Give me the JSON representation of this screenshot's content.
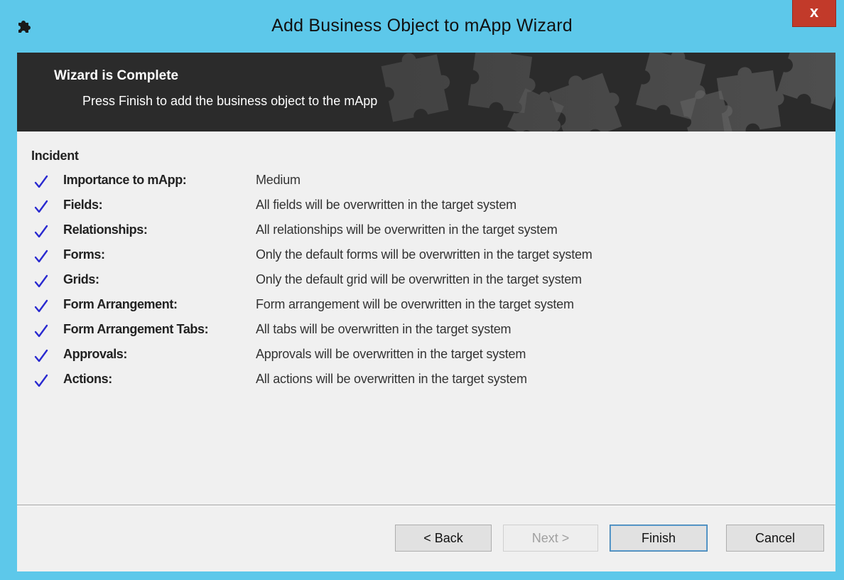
{
  "window": {
    "title": "Add Business Object to mApp Wizard",
    "close_label": "x",
    "icon": "puzzle-icon",
    "colors": {
      "titlebar": "#5dc8ea",
      "close": "#c23a2a",
      "banner": "#2b2b2b",
      "client": "#f0f0f0",
      "check": "#2a2ad0"
    }
  },
  "banner": {
    "title": "Wizard is Complete",
    "subtitle": "Press Finish to add the business object to the mApp"
  },
  "summary": {
    "object_name": "Incident",
    "items": [
      {
        "label": "Importance to mApp:",
        "value": "Medium",
        "icon": "checkmark-icon"
      },
      {
        "label": "Fields:",
        "value": "All fields will be overwritten in the target system",
        "icon": "checkmark-icon"
      },
      {
        "label": "Relationships:",
        "value": "All relationships will be overwritten in the target system",
        "icon": "checkmark-icon"
      },
      {
        "label": "Forms:",
        "value": "Only the default forms will be overwritten in the target system",
        "icon": "checkmark-icon"
      },
      {
        "label": "Grids:",
        "value": "Only the default grid will be overwritten in the target system",
        "icon": "checkmark-icon"
      },
      {
        "label": "Form Arrangement:",
        "value": "Form arrangement will be overwritten in the target system",
        "icon": "checkmark-icon"
      },
      {
        "label": "Form Arrangement Tabs:",
        "value": "All tabs will be overwritten in the target system",
        "icon": "checkmark-icon"
      },
      {
        "label": "Approvals:",
        "value": "Approvals will be overwritten in the target system",
        "icon": "checkmark-icon"
      },
      {
        "label": "Actions:",
        "value": "All actions will be overwritten in the target system",
        "icon": "checkmark-icon"
      }
    ]
  },
  "buttons": {
    "back": "< Back",
    "next": "Next >",
    "finish": "Finish",
    "cancel": "Cancel"
  }
}
